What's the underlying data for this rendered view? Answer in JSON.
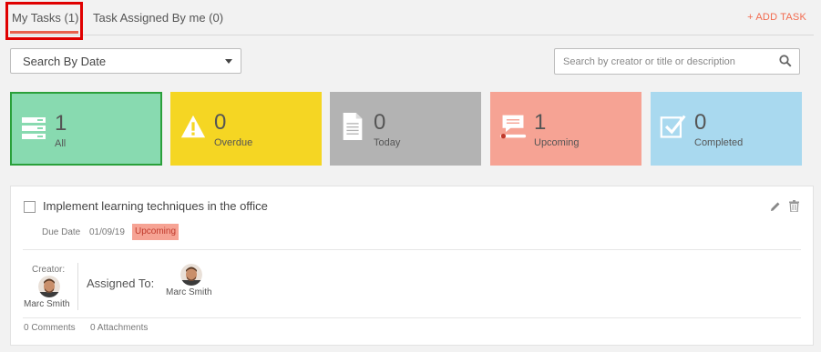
{
  "tabs": {
    "my_tasks": "My Tasks (1)",
    "assigned_by_me": "Task Assigned By me (0)",
    "add_task": "+ ADD TASK"
  },
  "filters": {
    "date_select": "Search By Date",
    "search_placeholder": "Search by creator or title or description"
  },
  "stats": [
    {
      "count": "1",
      "label": "All",
      "icon": "list-icon",
      "color": "#88dab0"
    },
    {
      "count": "0",
      "label": "Overdue",
      "icon": "warning-icon",
      "color": "#f5d623"
    },
    {
      "count": "0",
      "label": "Today",
      "icon": "document-icon",
      "color": "#b3b3b3"
    },
    {
      "count": "1",
      "label": "Upcoming",
      "icon": "chat-upcoming-icon",
      "color": "#f6a394"
    },
    {
      "count": "0",
      "label": "Completed",
      "icon": "checkbox-icon",
      "color": "#a9d9ef"
    }
  ],
  "task": {
    "title": "Implement learning techniques in the office",
    "due_label": "Due Date",
    "due_date": "01/09/19",
    "status": "Upcoming",
    "creator_label": "Creator:",
    "creator_name": "Marc Smith",
    "assigned_label": "Assigned To:",
    "assignee_name": "Marc Smith",
    "comments": "0 Comments",
    "attachments": "0 Attachments"
  },
  "colors": {
    "accent": "#f26b4f",
    "highlight": "#e00000",
    "status_badge": "#f6a394"
  }
}
